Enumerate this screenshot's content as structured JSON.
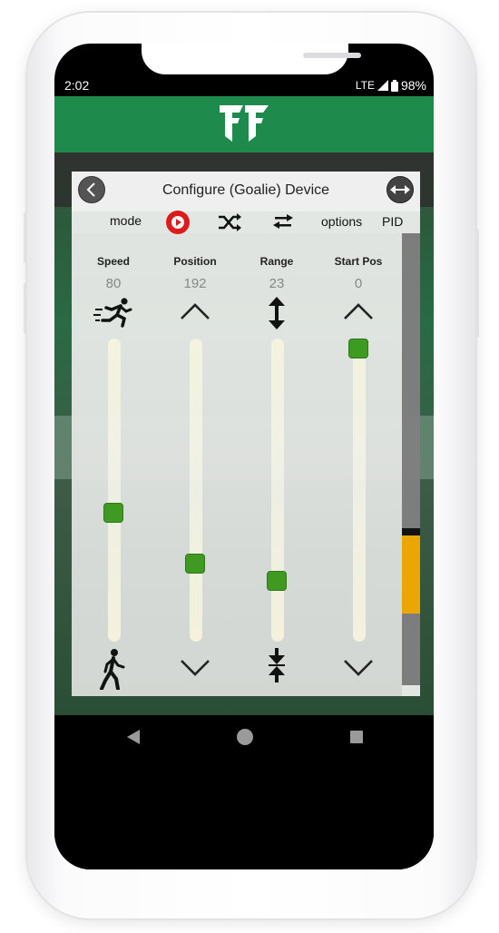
{
  "status_bar": {
    "time": "2:02",
    "network": "LTE",
    "battery": "98%"
  },
  "app_bar": {
    "logo_icon": "ff-logo-icon",
    "color": "#1e8a4c"
  },
  "dialog": {
    "title": "Configure (Goalie) Device",
    "back_icon": "chevron-left-icon",
    "connect_icon": "arrows-left-right-icon"
  },
  "toolbar": {
    "mode_label": "mode",
    "play_icon": "play-icon",
    "shuffle_icon": "shuffle-icon",
    "swap_icon": "swap-arrows-icon",
    "options_label": "options",
    "pid_label": "PID",
    "play_color": "#e21b1b"
  },
  "sliders": [
    {
      "label": "Speed",
      "value": "80",
      "top_icon": "running-person-icon",
      "bottom_icon": "walking-person-icon",
      "level": 0.42
    },
    {
      "label": "Position",
      "value": "192",
      "top_icon": "chevron-up-icon",
      "bottom_icon": "chevron-down-icon",
      "level": 0.24
    },
    {
      "label": "Range",
      "value": "23",
      "top_icon": "expand-vertical-icon",
      "bottom_icon": "compress-vertical-icon",
      "level": 0.18
    },
    {
      "label": "Start Pos",
      "value": "0",
      "top_icon": "chevron-up-icon",
      "bottom_icon": "chevron-down-icon",
      "level": 1.0
    }
  ],
  "colors": {
    "slider_thumb": "#3f9d21",
    "scroll_indicator": "#f2a900"
  },
  "nav_bar": {
    "back_icon": "nav-back-icon",
    "home_icon": "nav-home-icon",
    "recent_icon": "nav-recent-icon"
  }
}
